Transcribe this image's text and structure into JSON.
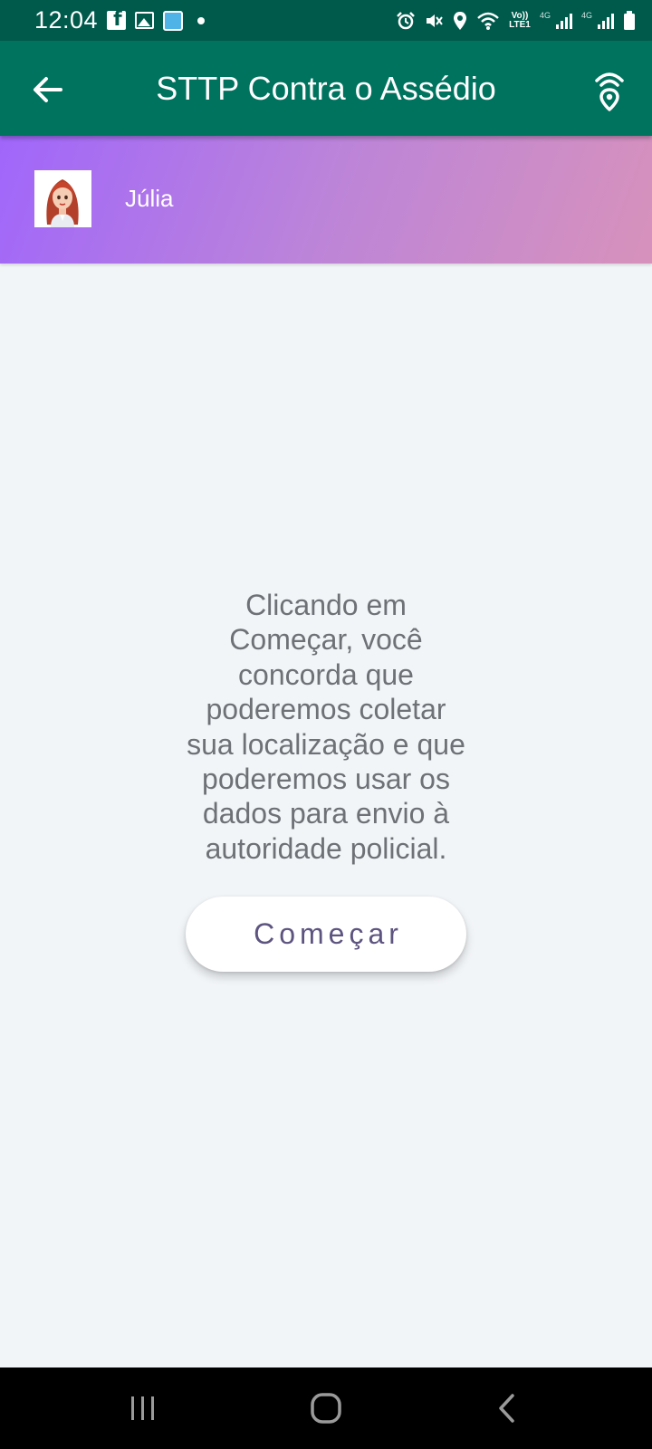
{
  "status_bar": {
    "time": "12:04",
    "volte_label": "Vo)) LTE1",
    "network_1": "4G",
    "network_2": "4G"
  },
  "app_bar": {
    "title": "STTP Contra o Assédio",
    "back_icon": "arrow-back-icon",
    "action_icon": "location-signal-icon"
  },
  "user": {
    "name": "Júlia",
    "avatar": "avatar-woman-red-hair"
  },
  "main": {
    "consent_text": "Clicando em Começar, você concorda que poderemos coletar sua localização e que poderemos usar os dados para envio à autoridade policial.",
    "start_button_label": "Começar"
  },
  "nav": {
    "recents_icon": "recents-icon",
    "home_icon": "home-icon",
    "back_icon": "back-chevron-icon"
  },
  "colors": {
    "status_bar": "#005a4c",
    "app_bar": "#00735f",
    "header_gradient_start": "#a066fb",
    "header_gradient_end": "#d792bb",
    "background": "#f2f5f8",
    "button_text": "#5e5480"
  }
}
